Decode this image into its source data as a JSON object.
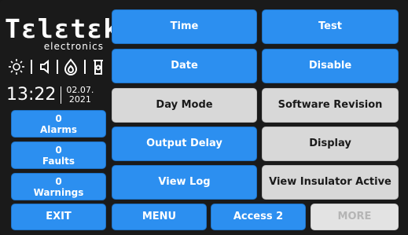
{
  "brand": {
    "name": "Tɛlɛtɛk",
    "subtitle": "electronics"
  },
  "status_icons": [
    "sun-icon",
    "speaker-icon",
    "flame-icon",
    "door-icon"
  ],
  "clock": {
    "time": "13:22",
    "date_day_month": "02.07.",
    "date_year": "2021"
  },
  "counters": {
    "alarms": {
      "count": "0",
      "label": "Alarms"
    },
    "faults": {
      "count": "0",
      "label": "Faults"
    },
    "warnings": {
      "count": "0",
      "label": "Warnings"
    }
  },
  "grid": {
    "time": "Time",
    "test": "Test",
    "date": "Date",
    "disable": "Disable",
    "day_mode": "Day Mode",
    "software_revision": "Software Revision",
    "output_delay": "Output Delay",
    "display": "Display",
    "view_log": "View Log",
    "view_insulator_active": "View Insulator Active"
  },
  "footer": {
    "exit": "EXIT",
    "menu": "MENU",
    "access": "Access 2",
    "more": "MORE"
  },
  "colors": {
    "background": "#1a1a1a",
    "blue": "#2c8ff0",
    "gray": "#d8d8d8",
    "disabled_text": "#b5b5b5"
  }
}
